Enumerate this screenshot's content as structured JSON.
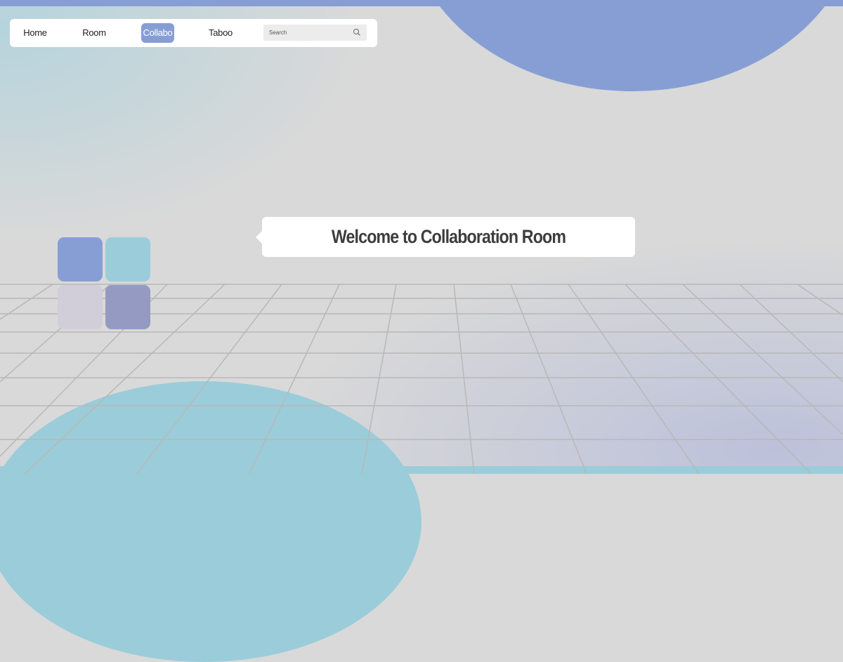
{
  "nav": {
    "items": [
      {
        "label": "Home",
        "active": false
      },
      {
        "label": "Room",
        "active": false
      },
      {
        "label": "Collabo",
        "active": true
      },
      {
        "label": "Taboo",
        "active": false
      }
    ],
    "search": {
      "placeholder": "Search",
      "icon": "search-icon"
    }
  },
  "welcome": {
    "text": "Welcome to Collaboration Room"
  },
  "colors": {
    "accent_blue": "#879ed5",
    "accent_cyan": "#9acdd9",
    "background": "#d9d9d9",
    "tile_lavender": "#d2ced9",
    "tile_slate": "#949ac2"
  }
}
